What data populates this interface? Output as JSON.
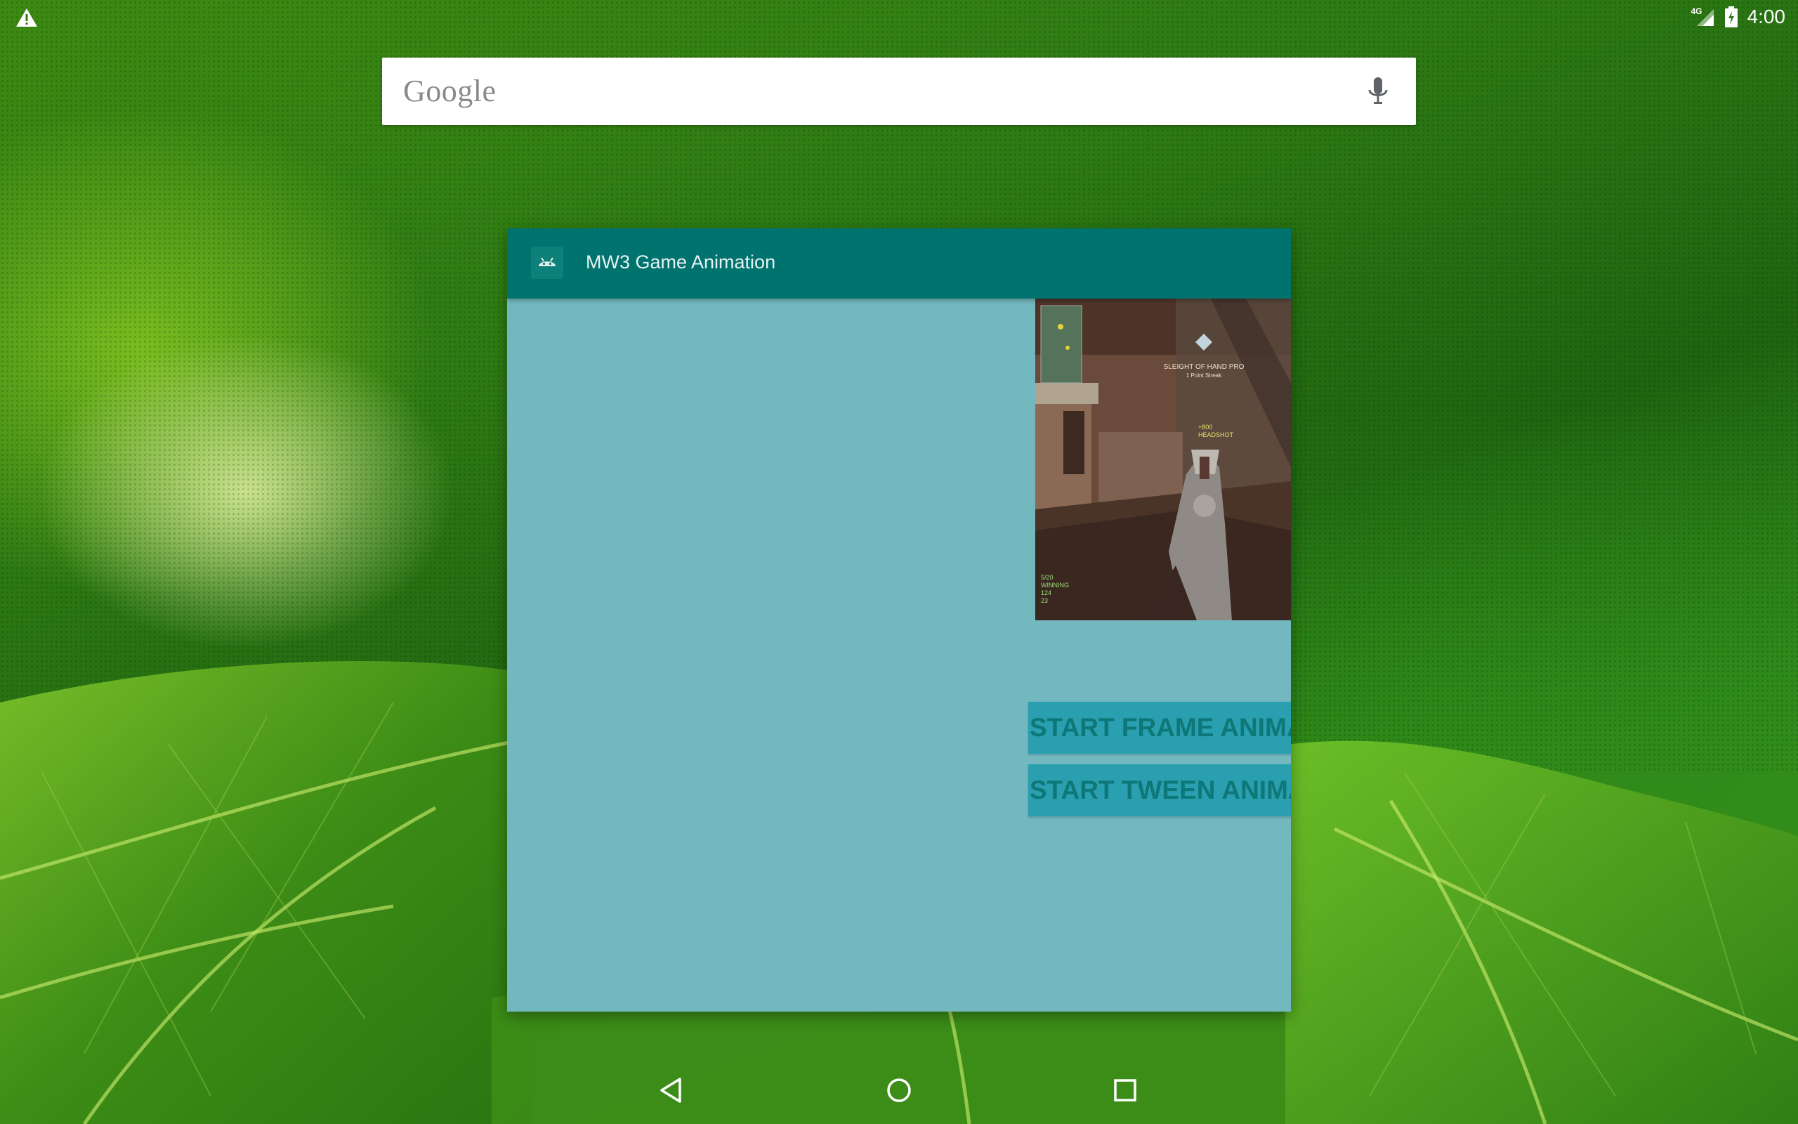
{
  "status_bar": {
    "warning_icon": "warning-icon",
    "network_label": "4G",
    "signal_icon": "cell-signal-icon",
    "battery_icon": "battery-charging-icon",
    "time": "4:00"
  },
  "search_widget": {
    "logo_text": "Google",
    "mic_icon": "mic-icon"
  },
  "app_window": {
    "icon": "android-icon",
    "title": "MW3 Game Animation",
    "image_icon": "game-screenshot-image",
    "buttons": {
      "frame_animation_label": "START FRAME ANIMATION",
      "tween_animation_label": "START TWEEN ANIMATION"
    }
  },
  "game_image_text": {
    "medal_line1": "SLEIGHT OF HAND PRO",
    "medal_line2": "1 Point Streak",
    "score_line1": "+800",
    "score_line2": "HEADSHOT",
    "hud_line1": "5/20",
    "hud_line2": "WINNING",
    "hud_line3": "124",
    "hud_line4": "23"
  },
  "nav_bar": {
    "back_icon": "back-triangle-icon",
    "home_icon": "home-circle-icon",
    "recents_icon": "recents-square-icon"
  },
  "colors": {
    "titlebar": "#00736e",
    "content_bg": "#73b8bf",
    "button_bg": "#2a9fb0",
    "button_text": "#0e7777"
  }
}
